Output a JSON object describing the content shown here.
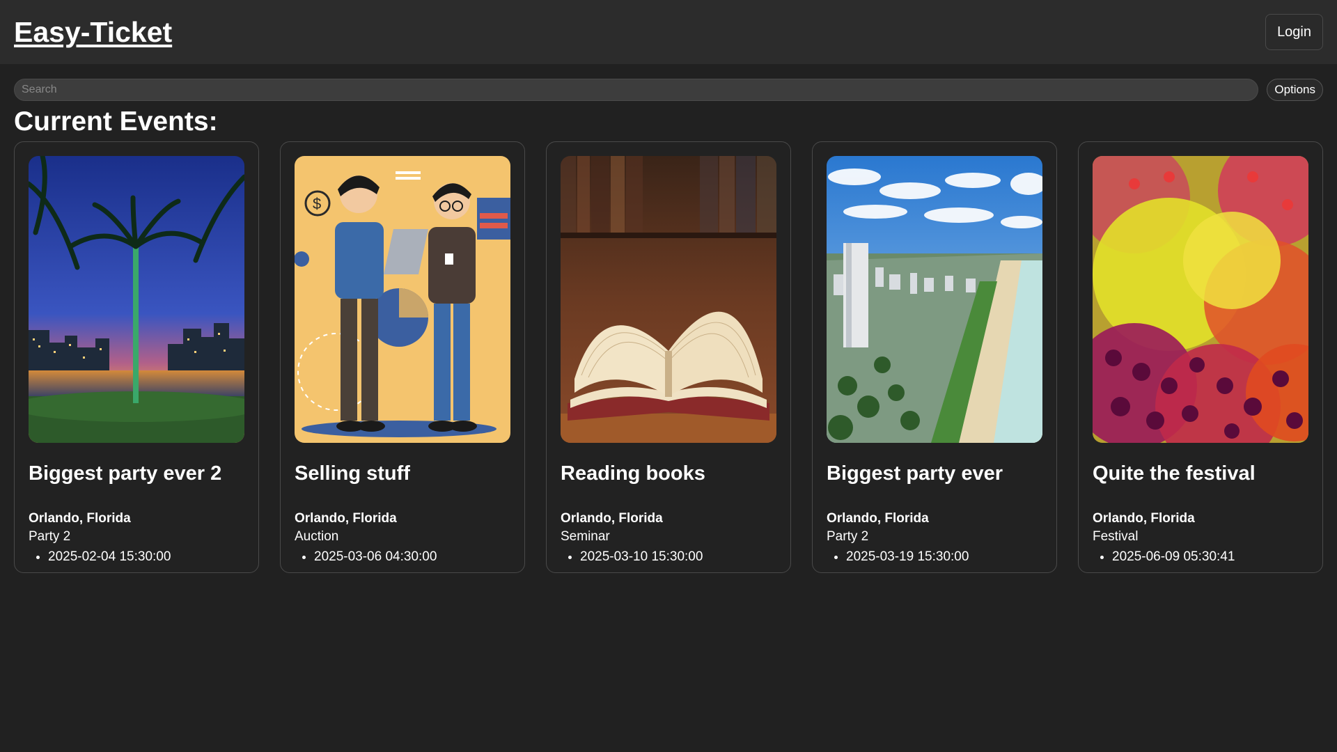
{
  "header": {
    "brand": "Easy-Ticket",
    "login_label": "Login"
  },
  "search": {
    "placeholder": "Search",
    "options_label": "Options"
  },
  "section_title": "Current Events:",
  "events": [
    {
      "title": "Biggest party ever 2",
      "location": "Orlando, Florida",
      "category": "Party 2",
      "date": "2025-02-04 15:30:00"
    },
    {
      "title": "Selling stuff",
      "location": "Orlando, Florida",
      "category": "Auction",
      "date": "2025-03-06 04:30:00"
    },
    {
      "title": "Reading books",
      "location": "Orlando, Florida",
      "category": "Seminar",
      "date": "2025-03-10 15:30:00"
    },
    {
      "title": "Biggest party ever",
      "location": "Orlando, Florida",
      "category": "Party 2",
      "date": "2025-03-19 15:30:00"
    },
    {
      "title": "Quite the festival",
      "location": "Orlando, Florida",
      "category": "Festival",
      "date": "2025-06-09 05:30:41"
    }
  ]
}
